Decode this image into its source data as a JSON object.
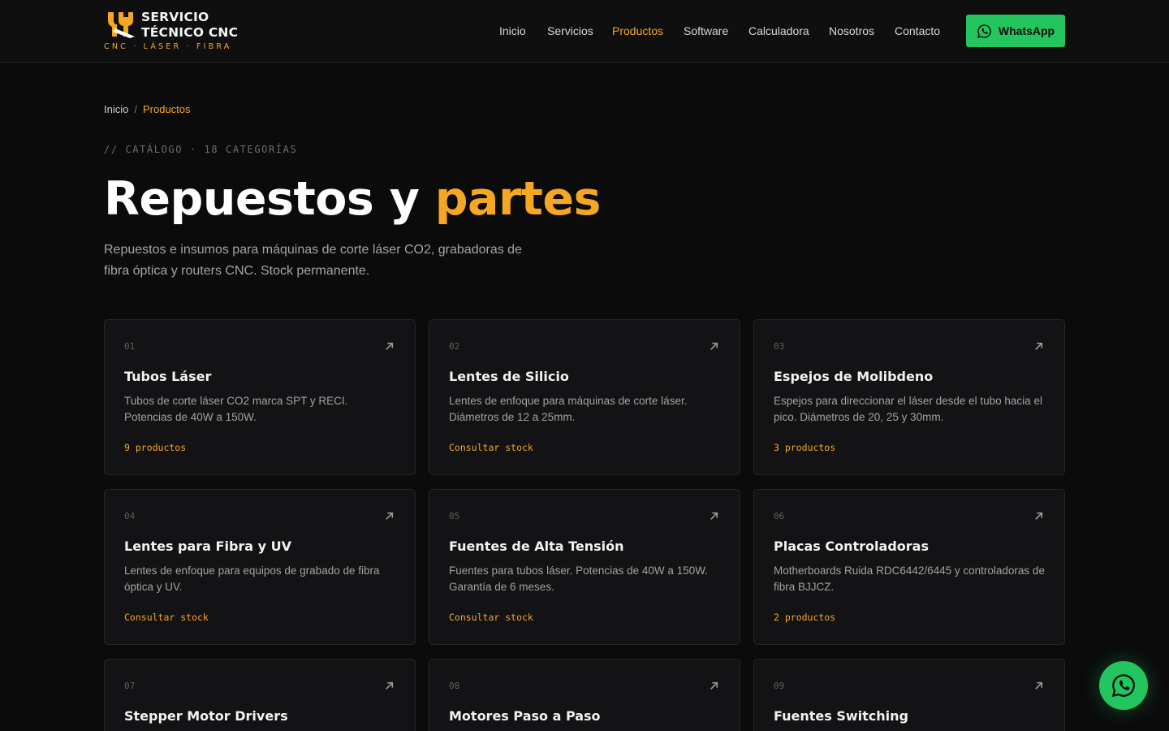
{
  "brand": {
    "line1": "SERVICIO",
    "line2": "TÉCNICO CNC",
    "tagline": "CNC · LÁSER · FIBRA",
    "accent_color": "#f5a623"
  },
  "nav": {
    "items": [
      {
        "label": "Inicio",
        "active": false
      },
      {
        "label": "Servicios",
        "active": false
      },
      {
        "label": "Productos",
        "active": true
      },
      {
        "label": "Software",
        "active": false
      },
      {
        "label": "Calculadora",
        "active": false
      },
      {
        "label": "Nosotros",
        "active": false
      },
      {
        "label": "Contacto",
        "active": false
      }
    ],
    "cta_label": "WhatsApp",
    "cta_icon": "whatsapp-icon",
    "cta_color": "#22c55e"
  },
  "breadcrumb": {
    "home": "Inicio",
    "separator": "/",
    "current": "Productos"
  },
  "hero": {
    "eyebrow": "// CATÁLOGO · 18 CATEGORÍAS",
    "title_main": "Repuestos y",
    "title_accent": "partes",
    "lead": "Repuestos e insumos para máquinas de corte láser CO2, grabadoras de fibra óptica y routers CNC. Stock permanente."
  },
  "categories": [
    {
      "num": "01",
      "title": "Tubos Láser",
      "desc": "Tubos de corte láser CO2 marca SPT y RECI. Potencias de 40W a 150W.",
      "meta": "9 productos"
    },
    {
      "num": "02",
      "title": "Lentes de Silicio",
      "desc": "Lentes de enfoque para máquinas de corte láser. Diámetros de 12 a 25mm.",
      "meta": "Consultar stock"
    },
    {
      "num": "03",
      "title": "Espejos de Molibdeno",
      "desc": "Espejos para direccionar el láser desde el tubo hacia el pico. Diámetros de 20, 25 y 30mm.",
      "meta": "3 productos"
    },
    {
      "num": "04",
      "title": "Lentes para Fibra y UV",
      "desc": "Lentes de enfoque para equipos de grabado de fibra óptica y UV.",
      "meta": "Consultar stock"
    },
    {
      "num": "05",
      "title": "Fuentes de Alta Tensión",
      "desc": "Fuentes para tubos láser. Potencias de 40W a 150W. Garantía de 6 meses.",
      "meta": "Consultar stock"
    },
    {
      "num": "06",
      "title": "Placas Controladoras",
      "desc": "Motherboards Ruida RDC6442/6445 y controladoras de fibra BJJCZ.",
      "meta": "2 productos"
    },
    {
      "num": "07",
      "title": "Stepper Motor Drivers",
      "desc": "",
      "meta": ""
    },
    {
      "num": "08",
      "title": "Motores Paso a Paso",
      "desc": "",
      "meta": ""
    },
    {
      "num": "09",
      "title": "Fuentes Switching",
      "desc": "",
      "meta": ""
    }
  ],
  "floating_button": {
    "icon": "whatsapp-icon"
  }
}
